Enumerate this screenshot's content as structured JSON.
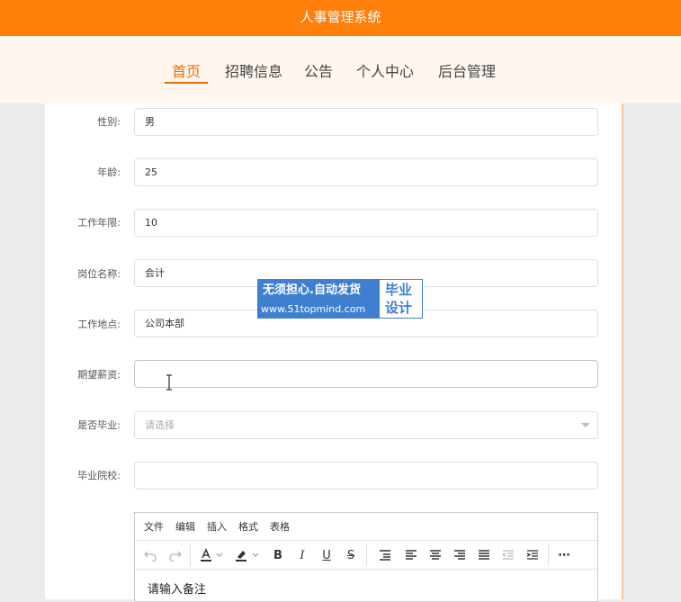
{
  "app": {
    "title": "人事管理系统"
  },
  "nav": {
    "items": [
      {
        "label": "首页",
        "active": true
      },
      {
        "label": "招聘信息"
      },
      {
        "label": "公告"
      },
      {
        "label": "个人中心"
      },
      {
        "label": "后台管理"
      }
    ]
  },
  "form": {
    "gender": {
      "label": "性别:",
      "value": "男"
    },
    "age": {
      "label": "年龄:",
      "value": "25"
    },
    "work_years": {
      "label": "工作年限:",
      "value": "10"
    },
    "position": {
      "label": "岗位名称:",
      "value": "会计"
    },
    "location": {
      "label": "工作地点:",
      "value": "公司本部"
    },
    "salary": {
      "label": "期望薪资:",
      "value": ""
    },
    "graduated": {
      "label": "是否毕业:",
      "placeholder": "请选择"
    },
    "school": {
      "label": "毕业院校:",
      "value": ""
    }
  },
  "editor": {
    "menus": [
      "文件",
      "编辑",
      "插入",
      "格式",
      "表格"
    ],
    "toolbar_icons": [
      "undo-icon",
      "redo-icon",
      "font-color-icon",
      "highlight-icon",
      "bold-icon",
      "italic-icon",
      "underline-icon",
      "strikethrough-icon",
      "line-height-icon",
      "align-left-icon",
      "align-center-icon",
      "align-right-icon",
      "align-justify-icon",
      "outdent-icon",
      "indent-icon",
      "more-icon"
    ],
    "placeholder": "请输入备注"
  },
  "watermark": {
    "line1": "无须担心.自动发货",
    "line2": "www.51topmind.com",
    "badge_line1": "毕业",
    "badge_line2": "设计"
  },
  "colors": {
    "accent": "#ff7f0b",
    "nav_bg": "#fff6ef",
    "active": "#e96f00",
    "watermark": "#3f7fd0"
  }
}
